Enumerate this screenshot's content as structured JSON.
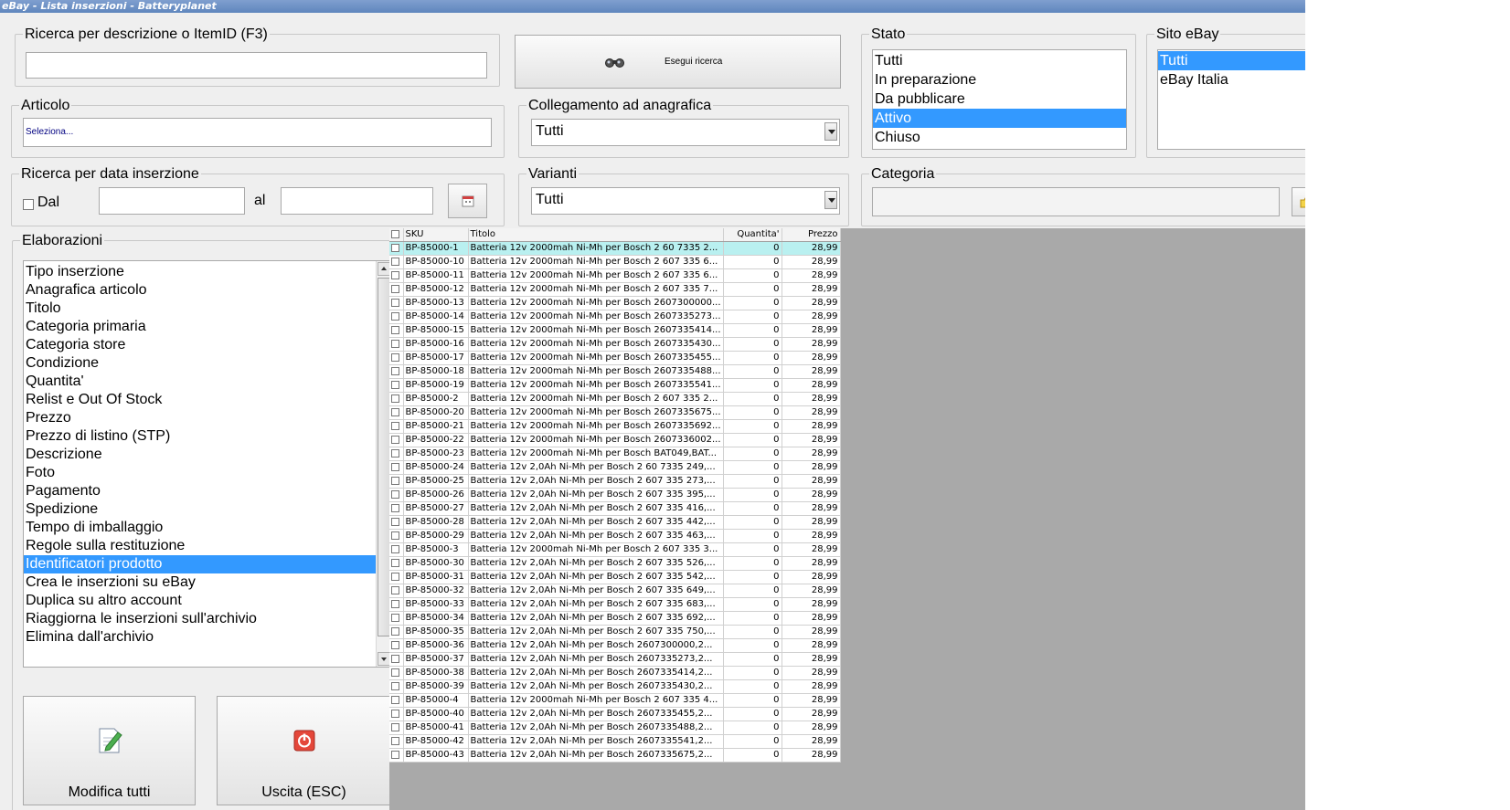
{
  "window": {
    "title": "eBay - Lista inserzioni - Batteryplanet"
  },
  "search": {
    "label": "Ricerca per descrizione o ItemID (F3)",
    "value": "",
    "button_label": "Esegui ricerca"
  },
  "articolo": {
    "label": "Articolo",
    "value": "Seleziona..."
  },
  "collegamento": {
    "label": "Collegamento ad anagrafica",
    "value": "Tutti"
  },
  "stato": {
    "label": "Stato",
    "items": [
      "Tutti",
      "In preparazione",
      "Da pubblicare",
      "Attivo",
      "Chiuso"
    ],
    "selected_index": 3
  },
  "sito": {
    "label": "Sito eBay",
    "items": [
      "Tutti",
      "eBay Italia"
    ],
    "selected_index": 0
  },
  "data_inserzione": {
    "label": "Ricerca per data inserzione",
    "from_label": "Dal",
    "to_label": "al",
    "from_value": "",
    "to_value": ""
  },
  "varianti": {
    "label": "Varianti",
    "value": "Tutti"
  },
  "categoria": {
    "label": "Categoria",
    "value": ""
  },
  "elaborazioni": {
    "label": "Elaborazioni",
    "items": [
      "Tipo inserzione",
      "Anagrafica articolo",
      "Titolo",
      "Categoria primaria",
      "Categoria store",
      "Condizione",
      "Quantita'",
      "Relist e Out Of Stock",
      "Prezzo",
      "Prezzo di listino (STP)",
      "Descrizione",
      "Foto",
      "Pagamento",
      "Spedizione",
      "Tempo di imballaggio",
      "Regole sulla restituzione",
      "Identificatori prodotto",
      "Crea le inserzioni su eBay",
      "Duplica su altro account",
      "Riaggiorna le inserzioni sull'archivio",
      "Elimina dall'archivio"
    ],
    "selected_index": 16
  },
  "buttons": {
    "modifica_label": "Modifica tutti",
    "uscita_label": "Uscita (ESC)"
  },
  "grid": {
    "columns": [
      "SKU",
      "Titolo",
      "Quantita'",
      "Prezzo"
    ],
    "rows": [
      {
        "sku": "BP-85000-1",
        "titolo": "Batteria 12v 2000mah Ni-Mh per Bosch 2 60 7335 2...",
        "qty": "0",
        "prezzo": "28,99"
      },
      {
        "sku": "BP-85000-10",
        "titolo": "Batteria 12v 2000mah Ni-Mh per Bosch 2 607 335 6...",
        "qty": "0",
        "prezzo": "28,99"
      },
      {
        "sku": "BP-85000-11",
        "titolo": "Batteria 12v 2000mah Ni-Mh per Bosch 2 607 335 6...",
        "qty": "0",
        "prezzo": "28,99"
      },
      {
        "sku": "BP-85000-12",
        "titolo": "Batteria 12v 2000mah Ni-Mh per Bosch 2 607 335 7...",
        "qty": "0",
        "prezzo": "28,99"
      },
      {
        "sku": "BP-85000-13",
        "titolo": "Batteria 12v 2000mah Ni-Mh per Bosch 2607300000...",
        "qty": "0",
        "prezzo": "28,99"
      },
      {
        "sku": "BP-85000-14",
        "titolo": "Batteria 12v 2000mah Ni-Mh per Bosch 2607335273...",
        "qty": "0",
        "prezzo": "28,99"
      },
      {
        "sku": "BP-85000-15",
        "titolo": "Batteria 12v 2000mah Ni-Mh per Bosch 2607335414...",
        "qty": "0",
        "prezzo": "28,99"
      },
      {
        "sku": "BP-85000-16",
        "titolo": "Batteria 12v 2000mah Ni-Mh per Bosch 2607335430...",
        "qty": "0",
        "prezzo": "28,99"
      },
      {
        "sku": "BP-85000-17",
        "titolo": "Batteria 12v 2000mah Ni-Mh per Bosch 2607335455...",
        "qty": "0",
        "prezzo": "28,99"
      },
      {
        "sku": "BP-85000-18",
        "titolo": "Batteria 12v 2000mah Ni-Mh per Bosch 2607335488...",
        "qty": "0",
        "prezzo": "28,99"
      },
      {
        "sku": "BP-85000-19",
        "titolo": "Batteria 12v 2000mah Ni-Mh per Bosch 2607335541...",
        "qty": "0",
        "prezzo": "28,99"
      },
      {
        "sku": "BP-85000-2",
        "titolo": "Batteria 12v 2000mah Ni-Mh per Bosch 2 607 335 2...",
        "qty": "0",
        "prezzo": "28,99"
      },
      {
        "sku": "BP-85000-20",
        "titolo": "Batteria 12v 2000mah Ni-Mh per Bosch 2607335675...",
        "qty": "0",
        "prezzo": "28,99"
      },
      {
        "sku": "BP-85000-21",
        "titolo": "Batteria 12v 2000mah Ni-Mh per Bosch 2607335692...",
        "qty": "0",
        "prezzo": "28,99"
      },
      {
        "sku": "BP-85000-22",
        "titolo": "Batteria 12v 2000mah Ni-Mh per Bosch 2607336002...",
        "qty": "0",
        "prezzo": "28,99"
      },
      {
        "sku": "BP-85000-23",
        "titolo": "Batteria 12v 2000mah Ni-Mh per Bosch BAT049,BAT...",
        "qty": "0",
        "prezzo": "28,99"
      },
      {
        "sku": "BP-85000-24",
        "titolo": "Batteria 12v 2,0Ah Ni-Mh per Bosch 2 60 7335 249,...",
        "qty": "0",
        "prezzo": "28,99"
      },
      {
        "sku": "BP-85000-25",
        "titolo": "Batteria 12v 2,0Ah Ni-Mh per Bosch 2 607 335 273,...",
        "qty": "0",
        "prezzo": "28,99"
      },
      {
        "sku": "BP-85000-26",
        "titolo": "Batteria 12v 2,0Ah Ni-Mh per Bosch 2 607 335 395,...",
        "qty": "0",
        "prezzo": "28,99"
      },
      {
        "sku": "BP-85000-27",
        "titolo": "Batteria 12v 2,0Ah Ni-Mh per Bosch 2 607 335 416,...",
        "qty": "0",
        "prezzo": "28,99"
      },
      {
        "sku": "BP-85000-28",
        "titolo": "Batteria 12v 2,0Ah Ni-Mh per Bosch 2 607 335 442,...",
        "qty": "0",
        "prezzo": "28,99"
      },
      {
        "sku": "BP-85000-29",
        "titolo": "Batteria 12v 2,0Ah Ni-Mh per Bosch 2 607 335 463,...",
        "qty": "0",
        "prezzo": "28,99"
      },
      {
        "sku": "BP-85000-3",
        "titolo": "Batteria 12v 2000mah Ni-Mh per Bosch 2 607 335 3...",
        "qty": "0",
        "prezzo": "28,99"
      },
      {
        "sku": "BP-85000-30",
        "titolo": "Batteria 12v 2,0Ah Ni-Mh per Bosch 2 607 335 526,...",
        "qty": "0",
        "prezzo": "28,99"
      },
      {
        "sku": "BP-85000-31",
        "titolo": "Batteria 12v 2,0Ah Ni-Mh per Bosch 2 607 335 542,...",
        "qty": "0",
        "prezzo": "28,99"
      },
      {
        "sku": "BP-85000-32",
        "titolo": "Batteria 12v 2,0Ah Ni-Mh per Bosch 2 607 335 649,...",
        "qty": "0",
        "prezzo": "28,99"
      },
      {
        "sku": "BP-85000-33",
        "titolo": "Batteria 12v 2,0Ah Ni-Mh per Bosch 2 607 335 683,...",
        "qty": "0",
        "prezzo": "28,99"
      },
      {
        "sku": "BP-85000-34",
        "titolo": "Batteria 12v 2,0Ah Ni-Mh per Bosch 2 607 335 692,...",
        "qty": "0",
        "prezzo": "28,99"
      },
      {
        "sku": "BP-85000-35",
        "titolo": "Batteria 12v 2,0Ah Ni-Mh per Bosch 2 607 335 750,...",
        "qty": "0",
        "prezzo": "28,99"
      },
      {
        "sku": "BP-85000-36",
        "titolo": "Batteria 12v 2,0Ah Ni-Mh per Bosch 2607300000,2...",
        "qty": "0",
        "prezzo": "28,99"
      },
      {
        "sku": "BP-85000-37",
        "titolo": "Batteria 12v 2,0Ah Ni-Mh per Bosch 2607335273,2...",
        "qty": "0",
        "prezzo": "28,99"
      },
      {
        "sku": "BP-85000-38",
        "titolo": "Batteria 12v 2,0Ah Ni-Mh per Bosch 2607335414,2...",
        "qty": "0",
        "prezzo": "28,99"
      },
      {
        "sku": "BP-85000-39",
        "titolo": "Batteria 12v 2,0Ah Ni-Mh per Bosch 2607335430,2...",
        "qty": "0",
        "prezzo": "28,99"
      },
      {
        "sku": "BP-85000-4",
        "titolo": "Batteria 12v 2000mah Ni-Mh per Bosch 2 607 335 4...",
        "qty": "0",
        "prezzo": "28,99"
      },
      {
        "sku": "BP-85000-40",
        "titolo": "Batteria 12v 2,0Ah Ni-Mh per Bosch 2607335455,2...",
        "qty": "0",
        "prezzo": "28,99"
      },
      {
        "sku": "BP-85000-41",
        "titolo": "Batteria 12v 2,0Ah Ni-Mh per Bosch 2607335488,2...",
        "qty": "0",
        "prezzo": "28,99"
      },
      {
        "sku": "BP-85000-42",
        "titolo": "Batteria 12v 2,0Ah Ni-Mh per Bosch 2607335541,2...",
        "qty": "0",
        "prezzo": "28,99"
      },
      {
        "sku": "BP-85000-43",
        "titolo": "Batteria 12v 2,0Ah Ni-Mh per Bosch 2607335675,2...",
        "qty": "0",
        "prezzo": "28,99"
      }
    ]
  },
  "colors": {
    "selection": "#3399ff",
    "current_row": "#b9f0f0",
    "grid_empty": "#a9a9a9",
    "titlebar": "#6f93c6"
  }
}
